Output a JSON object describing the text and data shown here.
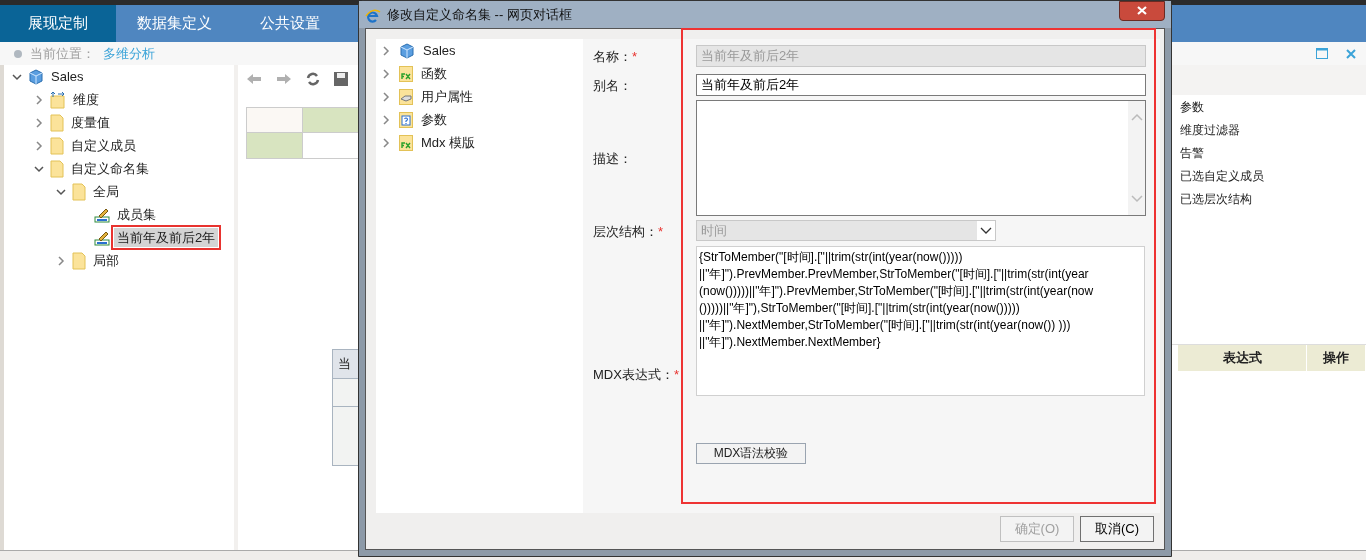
{
  "top_tabs": [
    {
      "label": "展现定制",
      "selected": true
    },
    {
      "label": "数据集定义",
      "selected": false
    },
    {
      "label": "公共设置",
      "selected": false
    }
  ],
  "breadcrumb": {
    "label": "当前位置：",
    "link": "多维分析"
  },
  "tree": [
    {
      "label": "Sales",
      "kind": "cube",
      "expanded": true,
      "selected": false,
      "children": [
        {
          "label": "维度",
          "kind": "dimension",
          "expanded": false,
          "selected": false
        },
        {
          "label": "度量值",
          "kind": "folder",
          "expanded": false,
          "selected": false
        },
        {
          "label": "自定义成员",
          "kind": "folder",
          "expanded": false,
          "selected": false
        },
        {
          "label": "自定义命名集",
          "kind": "folder",
          "expanded": true,
          "selected": false,
          "children": [
            {
              "label": "全局",
              "kind": "folder",
              "expanded": true,
              "selected": false,
              "children": [
                {
                  "label": "成员集",
                  "kind": "namedset",
                  "selected": false
                },
                {
                  "label": "当前年及前后2年",
                  "kind": "namedset",
                  "selected": true
                }
              ]
            },
            {
              "label": "局部",
              "kind": "folder",
              "expanded": false,
              "selected": false
            }
          ]
        }
      ]
    }
  ],
  "hidden_column": {
    "header": "当"
  },
  "right_panel": {
    "items": [
      "参数",
      "维度过滤器",
      "告警",
      "已选自定义成员",
      "已选层次结构"
    ],
    "columns": [
      "表达式",
      "操作"
    ]
  },
  "dialog": {
    "title": "修改自定义命名集 -- 网页对话框",
    "tree": [
      {
        "label": "Sales",
        "kind": "cube"
      },
      {
        "label": "函数",
        "kind": "function"
      },
      {
        "label": "用户属性",
        "kind": "attribute"
      },
      {
        "label": "参数",
        "kind": "parameter"
      },
      {
        "label": "Mdx 模版",
        "kind": "function"
      }
    ],
    "fields": [
      {
        "label": "名称：",
        "required": true,
        "kind": "text",
        "value": "当前年及前后2年",
        "disabled": true
      },
      {
        "label": "别名：",
        "required": false,
        "kind": "text",
        "value": "当前年及前后2年",
        "disabled": false
      },
      {
        "label": "描述：",
        "required": false,
        "kind": "textarea",
        "disabled": false
      },
      {
        "label": "层次结构：",
        "required": true,
        "kind": "select",
        "value": "时间",
        "disabled": true
      },
      {
        "label": "MDX表达式：",
        "required": true,
        "kind": "code",
        "value": "{StrToMember(\"[时间].[\"||trim(str(int(year(now())))) ||\"年]\").PrevMember.PrevMember,StrToMember(\"[时间].[\"||trim(str(int(year (now()))))||\"年]\").PrevMember,StrToMember(\"[时间].[\"||trim(str(int(year(now ()))))||\"年]\"),StrToMember(\"[时间].[\"||trim(str(int(year(now())))) ||\"年]\").NextMember,StrToMember(\"[时间].[\"||trim(str(int(year(now()) ))) ||\"年]\").NextMember.NextMember}",
        "disabled": false
      }
    ],
    "required_mark": "*",
    "check_button": "MDX语法校验",
    "buttons": [
      {
        "label": "确定(O)",
        "disabled": true
      },
      {
        "label": "取消(C)",
        "disabled": false
      }
    ]
  }
}
